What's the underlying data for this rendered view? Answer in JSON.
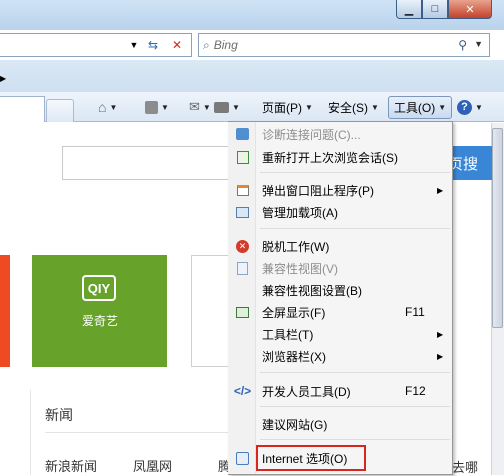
{
  "window": {
    "minimize_icon": "minimize-icon",
    "maximize_icon": "maximize-icon",
    "close_icon": "close-icon"
  },
  "search": {
    "placeholder": "Bing"
  },
  "command_bar": {
    "page_label": "页面(P)",
    "safety_label": "安全(S)",
    "tools_label": "工具(O)",
    "help_icon": "help-icon"
  },
  "page": {
    "search_button": "页搜",
    "tile_label": "爱奇艺",
    "tile_logo": "QIY",
    "news_title": "新闻",
    "news_links": [
      "新浪新闻",
      "凤凰网",
      "腾讯新",
      "去哪"
    ]
  },
  "tools_menu": {
    "items": [
      {
        "label": "诊断连接问题(C)...",
        "disabled": true,
        "icon": "diagnose-icon"
      },
      {
        "label": "重新打开上次浏览会话(S)",
        "disabled": false,
        "icon": "reopen-session-icon"
      },
      {
        "label": "弹出窗口阻止程序(P)",
        "disabled": false,
        "icon": "popup-blocker-icon",
        "submenu": true
      },
      {
        "label": "管理加载项(A)",
        "disabled": false,
        "icon": "addons-icon"
      },
      {
        "label": "脱机工作(W)",
        "disabled": false,
        "icon": "work-offline-icon"
      },
      {
        "label": "兼容性视图(V)",
        "disabled": true,
        "icon": "compat-view-icon"
      },
      {
        "label": "兼容性视图设置(B)",
        "disabled": false
      },
      {
        "label": "全屏显示(F)",
        "shortcut": "F11",
        "disabled": false,
        "icon": "fullscreen-icon"
      },
      {
        "label": "工具栏(T)",
        "disabled": false,
        "submenu": true
      },
      {
        "label": "浏览器栏(X)",
        "disabled": false,
        "submenu": true
      },
      {
        "label": "开发人员工具(D)",
        "shortcut": "F12",
        "disabled": false,
        "icon": "developer-tools-icon"
      },
      {
        "label": "建议网站(G)",
        "disabled": false
      },
      {
        "label": "Internet 选项(O)",
        "disabled": false,
        "icon": "internet-options-icon",
        "highlighted": true
      }
    ]
  },
  "colors": {
    "highlight_border": "#d9261c",
    "tile_green": "#67a32b",
    "tile_red": "#ef4b23",
    "search_button_blue": "#3a86d6"
  }
}
